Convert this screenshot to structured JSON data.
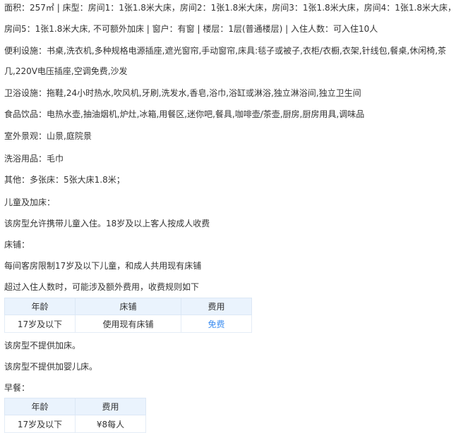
{
  "lines": {
    "l1": "面积：257㎡ | 床型：房间1：1张1.8米大床，房间2：1张1.8米大床，房间3：1张1.8米大床，房间4：1张1.8米大床，",
    "l2": "房间5：1张1.8米大床, 不可额外加床 | 窗户：有窗 | 楼层：1层(普通楼层) | 入住人数：可入住10人",
    "l3": "便利设施：书桌,洗衣机,多种规格电源插座,遮光窗帘,手动窗帘,床具:毯子或被子,衣柜/衣橱,衣架,针线包,餐桌,休闲椅,茶",
    "l4": "几,220V电压插座,空调免费,沙发",
    "l5": "卫浴设施：拖鞋,24小时热水,吹风机,牙刷,洗发水,香皂,浴巾,浴缸或淋浴,独立淋浴间,独立卫生间",
    "l6": "食品饮品：电热水壶,抽油烟机,炉灶,冰箱,用餐区,迷你吧,餐具,咖啡壶/茶壶,厨房,厨房用具,调味品",
    "l7": "室外景观：山景,庭院景",
    "l8": "洗浴用品：毛巾",
    "l9": "其他：多张床：5张大床1.8米；",
    "l10": "儿童及加床：",
    "l11": "该房型允许携带儿童入住。18岁及以上客人按成人收费",
    "l12": "床铺：",
    "l13": "每间客房限制17岁及以下儿童，和成人共用现有床铺",
    "l14": "超过入住人数时，可能涉及额外费用，收费规则如下",
    "l15": "该房型不提供加床。",
    "l16": "该房型不提供加婴儿床。",
    "l17": "早餐："
  },
  "bed_table": {
    "headers": [
      "年龄",
      "床铺",
      "费用"
    ],
    "row": [
      "17岁及以下",
      "使用现有床铺",
      "免费"
    ]
  },
  "breakfast_table": {
    "headers": [
      "年龄",
      "费用"
    ],
    "row": [
      "17岁及以下",
      "¥8每人"
    ]
  },
  "colors": {
    "header_bg": "#eaf3fd",
    "free_link": "#3a8cf0",
    "text": "#333333"
  }
}
